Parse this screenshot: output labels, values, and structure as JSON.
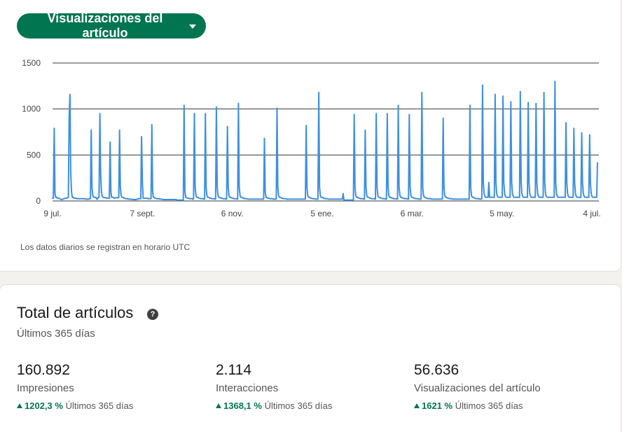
{
  "chart_card": {
    "dropdown_label": "Visualizaciones del artículo",
    "utc_note": "Los datos diarios se registran en horario UTC"
  },
  "chart_data": {
    "type": "line",
    "title": "",
    "xlabel": "",
    "ylabel": "",
    "ylim": [
      0,
      1500
    ],
    "yticks": [
      0,
      500,
      1000,
      1500
    ],
    "xtick_labels": [
      "9 jul.",
      "7 sept.",
      "6 nov.",
      "5 ene.",
      "6 mar.",
      "5 may.",
      "4 jul."
    ],
    "grid": true,
    "color": "#3d8fe0",
    "series": [
      {
        "name": "",
        "values": [
          30,
          30,
          30,
          790,
          80,
          40,
          40,
          30,
          30,
          30,
          25,
          20,
          15,
          15,
          20,
          25,
          25,
          30,
          30,
          30,
          35,
          40,
          900,
          1160,
          300,
          100,
          40,
          40,
          30,
          30,
          30,
          30,
          25,
          25,
          25,
          25,
          25,
          25,
          25,
          25,
          25,
          25,
          25,
          20,
          20,
          20,
          20,
          20,
          25,
          25,
          770,
          150,
          60,
          40,
          40,
          40,
          40,
          20,
          20,
          40,
          40,
          950,
          300,
          100,
          50,
          40,
          35,
          35,
          35,
          35,
          30,
          30,
          30,
          30,
          640,
          100,
          40,
          40,
          40,
          30,
          30,
          35,
          35,
          35,
          35,
          35,
          770,
          150,
          60,
          40,
          40,
          35,
          30,
          30,
          25,
          25,
          25,
          20,
          20,
          20,
          20,
          20,
          15,
          15,
          15,
          15,
          15,
          15,
          20,
          20,
          25,
          25,
          25,
          25,
          700,
          200,
          30,
          30,
          30,
          30,
          30,
          30,
          25,
          25,
          25,
          25,
          25,
          830,
          100,
          40,
          40,
          30,
          30,
          25,
          25,
          25,
          25,
          20,
          20,
          20,
          20,
          15,
          15,
          15,
          15,
          15,
          15,
          15,
          15,
          15,
          15,
          15,
          15,
          15,
          15,
          15,
          15,
          15,
          15,
          10,
          10,
          10,
          10,
          10,
          10,
          10,
          10,
          10,
          1040,
          100,
          40,
          40,
          30,
          30,
          30,
          25,
          25,
          25,
          25,
          20,
          20,
          950,
          150,
          60,
          40,
          40,
          35,
          30,
          30,
          25,
          25,
          25,
          25,
          20,
          20,
          950,
          150,
          60,
          40,
          40,
          35,
          30,
          30,
          25,
          25,
          25,
          25,
          20,
          20,
          1020,
          150,
          60,
          40,
          40,
          35,
          30,
          30,
          25,
          25,
          25,
          25,
          20,
          20,
          810,
          150,
          60,
          40,
          40,
          35,
          30,
          30,
          25,
          25,
          25,
          25,
          20,
          20,
          1060,
          150,
          60,
          40,
          40,
          35,
          30,
          30,
          25,
          25,
          25,
          25,
          20,
          20,
          20,
          20,
          20,
          20,
          20,
          20,
          20,
          20,
          20,
          20,
          20,
          20,
          20,
          20,
          20,
          20,
          20,
          20,
          20,
          680,
          100,
          40,
          40,
          30,
          30,
          30,
          25,
          25,
          25,
          25,
          20,
          20,
          20,
          20,
          20,
          1010,
          150,
          60,
          40,
          40,
          35,
          30,
          30,
          25,
          25,
          25,
          25,
          20,
          20,
          20,
          20,
          20,
          20,
          20,
          20,
          20,
          20,
          20,
          20,
          20,
          20,
          20,
          20,
          20,
          20,
          20,
          20,
          20,
          20,
          20,
          20,
          20,
          820,
          150,
          60,
          40,
          40,
          35,
          30,
          30,
          25,
          25,
          25,
          25,
          20,
          20,
          20,
          20,
          1180,
          150,
          60,
          40,
          40,
          35,
          30,
          30,
          25,
          25,
          25,
          25,
          20,
          20,
          20,
          20,
          20,
          20,
          20,
          20,
          20,
          20,
          20,
          20,
          20,
          20,
          20,
          20,
          20,
          20,
          20,
          80,
          10,
          10,
          10,
          10,
          10,
          10,
          10,
          10,
          10,
          10,
          10,
          10,
          10,
          940,
          150,
          60,
          40,
          40,
          35,
          30,
          30,
          25,
          25,
          25,
          25,
          20,
          20,
          770,
          150,
          60,
          40,
          40,
          35,
          30,
          30,
          25,
          25,
          25,
          25,
          20,
          20,
          950,
          150,
          60,
          40,
          40,
          35,
          30,
          30,
          25,
          25,
          25,
          25,
          20,
          20,
          950,
          150,
          60,
          40,
          40,
          35,
          30,
          30,
          25,
          25,
          25,
          25,
          20,
          20,
          1040,
          150,
          60,
          40,
          40,
          35,
          30,
          30,
          25,
          25,
          25,
          25,
          20,
          20,
          940,
          150,
          60,
          40,
          40,
          35,
          30,
          30,
          25,
          25,
          25,
          25,
          20,
          20,
          20,
          20,
          1180,
          150,
          60,
          40,
          40,
          35,
          30,
          30,
          25,
          25,
          25,
          25,
          20,
          20,
          20,
          20,
          20,
          20,
          20,
          20,
          20,
          20,
          20,
          20,
          20,
          20,
          20,
          900,
          150,
          60,
          40,
          40,
          35,
          30,
          30,
          25,
          25,
          25,
          25,
          20,
          20,
          20,
          20,
          20,
          20,
          20,
          20,
          20,
          20,
          20,
          20,
          20,
          20,
          20,
          20,
          20,
          20,
          20,
          20,
          20,
          20,
          1040,
          150,
          60,
          40,
          40,
          35,
          30,
          30,
          25,
          25,
          25,
          25,
          20,
          20,
          20,
          20,
          1260,
          200,
          80,
          50,
          40,
          40,
          40,
          40,
          200,
          40,
          40,
          40,
          40,
          40,
          40,
          40,
          1160,
          200,
          80,
          50,
          40,
          40,
          40,
          40,
          40,
          40,
          1140,
          200,
          80,
          50,
          40,
          40,
          40,
          40,
          40,
          40,
          1080,
          200,
          80,
          50,
          40,
          40,
          40,
          40,
          40,
          40,
          40,
          40,
          1190,
          200,
          80,
          50,
          40,
          40,
          40,
          40,
          40,
          40,
          1070,
          200,
          80,
          50,
          40,
          40,
          40,
          40,
          40,
          40,
          1060,
          200,
          80,
          50,
          40,
          40,
          40,
          40,
          40,
          40,
          1180,
          200,
          80,
          50,
          40,
          40,
          40,
          40,
          40,
          40,
          40,
          40,
          40,
          40,
          1300,
          200,
          80,
          50,
          40,
          40,
          40,
          40,
          40,
          40,
          40,
          40,
          40,
          40,
          850,
          200,
          80,
          50,
          40,
          40,
          40,
          40,
          40,
          40,
          790,
          200,
          80,
          50,
          40,
          40,
          40,
          40,
          40,
          40,
          740,
          200,
          80,
          50,
          40,
          40,
          40,
          40,
          40,
          40,
          720,
          200,
          80,
          50,
          40,
          40,
          40,
          40,
          40,
          40,
          420
        ]
      }
    ]
  },
  "totals": {
    "title": "Total de artículos",
    "help_icon": "question-circle-icon",
    "help_glyph": "?",
    "subtitle": "Últimos 365 días",
    "stats": [
      {
        "value": "160.892",
        "label": "Impresiones",
        "change": "1202,3 %",
        "period": "Últimos 365 días"
      },
      {
        "value": "2.114",
        "label": "Interacciones",
        "change": "1368,1 %",
        "period": "Últimos 365 días"
      },
      {
        "value": "56.636",
        "label": "Visualizaciones del artículo",
        "change": "1621 %",
        "period": "Últimos 365 días"
      }
    ]
  },
  "colors": {
    "brand_green": "#01754f",
    "line_blue": "#3d8fe0"
  }
}
